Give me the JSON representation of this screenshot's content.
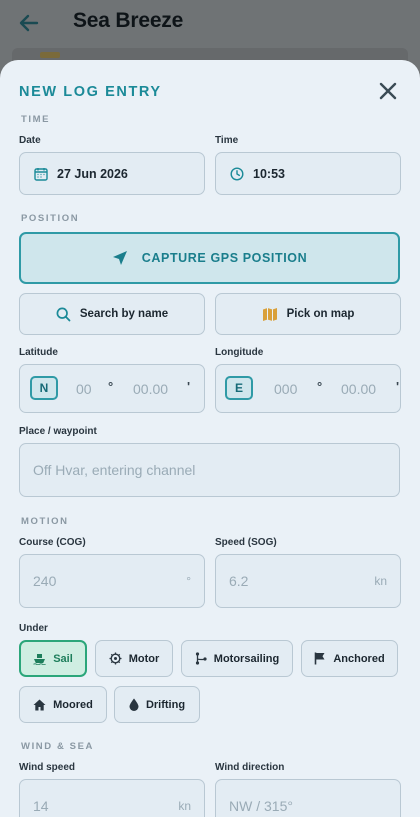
{
  "appbar": {
    "title": "Sea Breeze"
  },
  "sheet": {
    "title": "NEW LOG ENTRY",
    "sections": {
      "time": "TIME",
      "position": "POSITION",
      "motion": "MOTION",
      "wind_sea": "WIND & SEA"
    },
    "date": {
      "label": "Date",
      "value": "27 Jun 2026"
    },
    "time": {
      "label": "Time",
      "value": "10:53"
    },
    "gps_button": "CAPTURE GPS POSITION",
    "search_button": "Search by name",
    "map_button": "Pick on map",
    "latitude": {
      "label": "Latitude",
      "hemisphere": "N",
      "degrees_placeholder": "00",
      "degree_symbol": "°",
      "minutes_placeholder": "00.00",
      "minute_symbol": "'"
    },
    "longitude": {
      "label": "Longitude",
      "hemisphere": "E",
      "degrees_placeholder": "000",
      "degree_symbol": "°",
      "minutes_placeholder": "00.00",
      "minute_symbol": "'"
    },
    "place": {
      "label": "Place / waypoint",
      "placeholder": "Off Hvar, entering channel"
    },
    "course": {
      "label": "Course (COG)",
      "placeholder": "240",
      "unit": "°"
    },
    "speed": {
      "label": "Speed (SOG)",
      "placeholder": "6.2",
      "unit": "kn"
    },
    "under": {
      "label": "Under",
      "options": [
        "Sail",
        "Motor",
        "Motorsailing",
        "Anchored",
        "Moored",
        "Drifting"
      ],
      "selected": "Sail"
    },
    "wind_speed": {
      "label": "Wind speed",
      "placeholder": "14",
      "unit": "kn"
    },
    "wind_direction": {
      "label": "Wind direction",
      "placeholder": "NW / 315°"
    }
  },
  "colors": {
    "accent": "#1b8a98",
    "selected_chip": "#2ba67a",
    "sheet_bg": "#eaf1f7"
  }
}
